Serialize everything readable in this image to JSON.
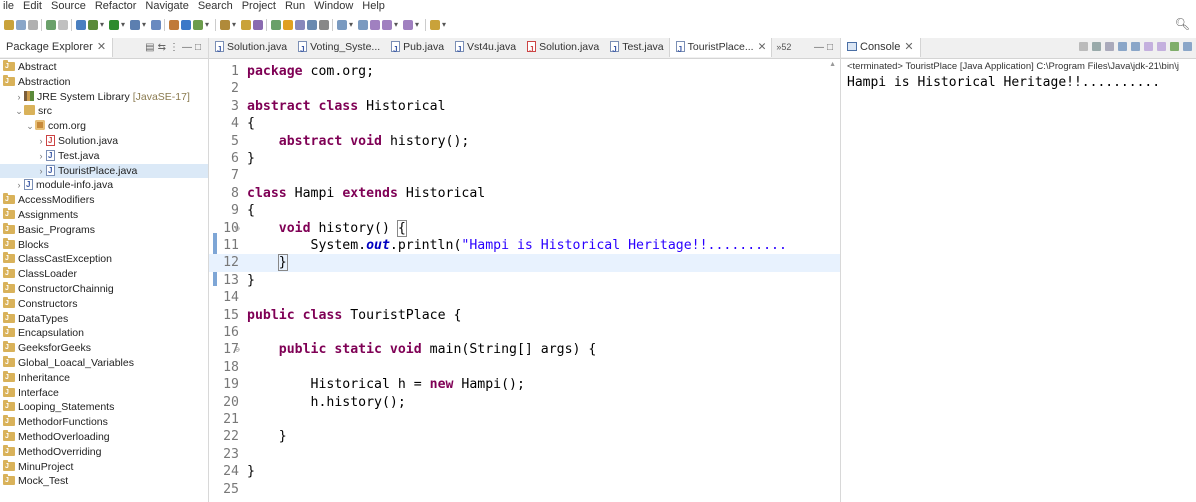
{
  "menu": [
    "ile",
    "Edit",
    "Source",
    "Refactor",
    "Navigate",
    "Search",
    "Project",
    "Run",
    "Window",
    "Help"
  ],
  "package_explorer": {
    "tab_label": "Package Explorer",
    "items": [
      {
        "label": "Abstract",
        "indent": 0,
        "kind": "project"
      },
      {
        "label": "Abstraction",
        "indent": 0,
        "kind": "project"
      },
      {
        "label": "JRE System Library",
        "suffix": "[JavaSE-17]",
        "indent": 1,
        "kind": "library",
        "chevron": ">"
      },
      {
        "label": "src",
        "indent": 1,
        "kind": "src",
        "chevron": "v"
      },
      {
        "label": "com.org",
        "indent": 2,
        "kind": "package",
        "chevron": "v"
      },
      {
        "label": "Solution.java",
        "indent": 3,
        "kind": "java-err",
        "chevron": ">"
      },
      {
        "label": "Test.java",
        "indent": 3,
        "kind": "java",
        "chevron": ">"
      },
      {
        "label": "TouristPlace.java",
        "indent": 3,
        "kind": "java",
        "chevron": ">",
        "selected": true
      },
      {
        "label": "module-info.java",
        "indent": 1,
        "kind": "java",
        "chevron": ">"
      },
      {
        "label": "AccessModifiers",
        "indent": 0,
        "kind": "project"
      },
      {
        "label": "Assignments",
        "indent": 0,
        "kind": "project"
      },
      {
        "label": "Basic_Programs",
        "indent": 0,
        "kind": "project"
      },
      {
        "label": "Blocks",
        "indent": 0,
        "kind": "project"
      },
      {
        "label": "ClassCastException",
        "indent": 0,
        "kind": "project"
      },
      {
        "label": "ClassLoader",
        "indent": 0,
        "kind": "project"
      },
      {
        "label": "ConstructorChainnig",
        "indent": 0,
        "kind": "project"
      },
      {
        "label": "Constructors",
        "indent": 0,
        "kind": "project"
      },
      {
        "label": "DataTypes",
        "indent": 0,
        "kind": "project"
      },
      {
        "label": "Encapsulation",
        "indent": 0,
        "kind": "project"
      },
      {
        "label": "GeeksforGeeks",
        "indent": 0,
        "kind": "project"
      },
      {
        "label": "Global_Loacal_Variables",
        "indent": 0,
        "kind": "project"
      },
      {
        "label": "Inheritance",
        "indent": 0,
        "kind": "project"
      },
      {
        "label": "Interface",
        "indent": 0,
        "kind": "project"
      },
      {
        "label": "Looping_Statements",
        "indent": 0,
        "kind": "project"
      },
      {
        "label": "MethodorFunctions",
        "indent": 0,
        "kind": "project"
      },
      {
        "label": "MethodOverloading",
        "indent": 0,
        "kind": "project"
      },
      {
        "label": "MethodOverriding",
        "indent": 0,
        "kind": "project"
      },
      {
        "label": "MinuProject",
        "indent": 0,
        "kind": "project"
      },
      {
        "label": "Mock_Test",
        "indent": 0,
        "kind": "project"
      }
    ]
  },
  "editor": {
    "tabs": [
      {
        "label": "Solution.java"
      },
      {
        "label": "Voting_Syste..."
      },
      {
        "label": "Pub.java"
      },
      {
        "label": "Vst4u.java"
      },
      {
        "label": "Solution.java",
        "error": true
      },
      {
        "label": "Test.java"
      },
      {
        "label": "TouristPlace...",
        "active": true
      }
    ],
    "more_tabs": "»52",
    "lines": [
      {
        "n": "1",
        "tokens": [
          [
            "kw",
            "package"
          ],
          [
            "",
            "com.org;"
          ]
        ]
      },
      {
        "n": "2",
        "tokens": []
      },
      {
        "n": "3",
        "tokens": [
          [
            "kw",
            "abstract class"
          ],
          [
            "",
            "Historical"
          ]
        ]
      },
      {
        "n": "4",
        "tokens": [
          [
            "",
            "{"
          ]
        ]
      },
      {
        "n": "5",
        "tokens": [
          [
            "",
            "    "
          ],
          [
            "kw",
            "abstract void"
          ],
          [
            "",
            "history();"
          ]
        ]
      },
      {
        "n": "6",
        "tokens": [
          [
            "",
            "}"
          ]
        ]
      },
      {
        "n": "7",
        "tokens": []
      },
      {
        "n": "8",
        "tokens": [
          [
            "kw",
            "class"
          ],
          [
            "",
            "Hampi"
          ],
          [
            "kw",
            "extends"
          ],
          [
            "",
            "Historical"
          ]
        ]
      },
      {
        "n": "9",
        "tokens": [
          [
            "",
            "{"
          ]
        ]
      },
      {
        "n": "10",
        "tokens": [
          [
            "",
            "    "
          ],
          [
            "kw",
            "void"
          ],
          [
            "",
            "history() "
          ],
          [
            "box",
            "{"
          ]
        ],
        "fold": true
      },
      {
        "n": "11",
        "tokens": [
          [
            "",
            "        System."
          ],
          [
            "fld",
            "out"
          ],
          [
            "",
            ".println("
          ],
          [
            "st",
            "\"Hampi is Historical Heritage!!.........."
          ]
        ]
      },
      {
        "n": "12",
        "tokens": [
          [
            "",
            "    "
          ],
          [
            "box",
            "}"
          ]
        ],
        "current": true
      },
      {
        "n": "13",
        "tokens": [
          [
            "",
            "}"
          ]
        ]
      },
      {
        "n": "14",
        "tokens": []
      },
      {
        "n": "15",
        "tokens": [
          [
            "kw",
            "public class"
          ],
          [
            "",
            "TouristPlace {"
          ]
        ]
      },
      {
        "n": "16",
        "tokens": []
      },
      {
        "n": "17",
        "tokens": [
          [
            "",
            "    "
          ],
          [
            "kw",
            "public static void"
          ],
          [
            "",
            "main(String[] args) {"
          ]
        ],
        "fold": true
      },
      {
        "n": "18",
        "tokens": []
      },
      {
        "n": "19",
        "tokens": [
          [
            "",
            "        Historical h = "
          ],
          [
            "kw",
            "new"
          ],
          [
            "",
            "Hampi();"
          ]
        ]
      },
      {
        "n": "20",
        "tokens": [
          [
            "",
            "        h.history();"
          ]
        ]
      },
      {
        "n": "21",
        "tokens": []
      },
      {
        "n": "22",
        "tokens": [
          [
            "",
            "    }"
          ]
        ]
      },
      {
        "n": "23",
        "tokens": []
      },
      {
        "n": "24",
        "tokens": [
          [
            "",
            "}"
          ]
        ]
      },
      {
        "n": "25",
        "tokens": []
      }
    ]
  },
  "console": {
    "tab_label": "Console",
    "terminated": "<terminated> TouristPlace [Java Application] C:\\Program Files\\Java\\jdk-21\\bin\\j",
    "output": "Hampi is Historical Heritage!!.........."
  },
  "colors": {
    "keyword": "#7f0055",
    "string": "#2a00ff",
    "field": "#0000c0",
    "current_line": "#e8f2fe",
    "selection": "#dbe9f7"
  }
}
